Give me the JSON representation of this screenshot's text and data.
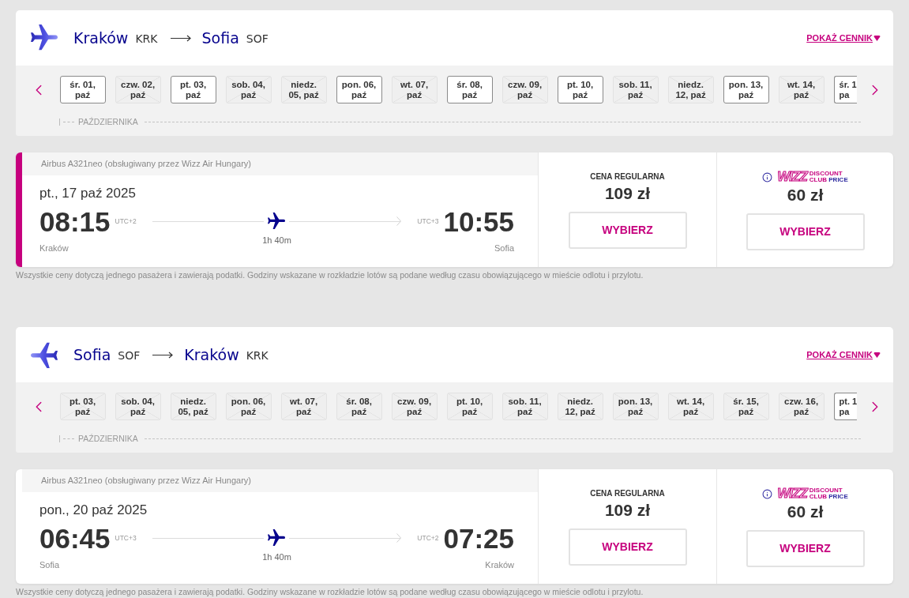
{
  "sections": [
    {
      "kind": "outbound",
      "origin": {
        "city": "Kraków",
        "code": "KRK"
      },
      "destination": {
        "city": "Sofia",
        "code": "SOF"
      },
      "price_list_link": "POKAŻ CENNIK",
      "dates": [
        {
          "lines": [
            "śr. 01,",
            "paź"
          ],
          "available": true
        },
        {
          "lines": [
            "czw. 02,",
            "paź"
          ],
          "available": false
        },
        {
          "lines": [
            "pt. 03,",
            "paź"
          ],
          "available": true
        },
        {
          "lines": [
            "sob. 04,",
            "paź"
          ],
          "available": false
        },
        {
          "lines": [
            "niedz.",
            "05, paź"
          ],
          "available": false
        },
        {
          "lines": [
            "pon. 06,",
            "paź"
          ],
          "available": true
        },
        {
          "lines": [
            "wt. 07,",
            "paź"
          ],
          "available": false
        },
        {
          "lines": [
            "śr. 08,",
            "paź"
          ],
          "available": true
        },
        {
          "lines": [
            "czw. 09,",
            "paź"
          ],
          "available": false
        },
        {
          "lines": [
            "pt. 10,",
            "paź"
          ],
          "available": true
        },
        {
          "lines": [
            "sob. 11,",
            "paź"
          ],
          "available": false
        },
        {
          "lines": [
            "niedz.",
            "12, paź"
          ],
          "available": false
        },
        {
          "lines": [
            "pon. 13,",
            "paź"
          ],
          "available": true
        },
        {
          "lines": [
            "wt. 14,",
            "paź"
          ],
          "available": false
        },
        {
          "lines": [
            "śr. 1",
            "pa"
          ],
          "available": true,
          "cut": true
        }
      ],
      "month_label": "PAŹDZIERNIKA",
      "flight": {
        "selected": true,
        "aircraft": "Airbus A321neo (obsługiwany przez Wizz Air Hungary)",
        "date": "pt., 17 paź 2025",
        "departure": {
          "time": "08:15",
          "utc": "UTC+2",
          "city": "Kraków"
        },
        "arrival": {
          "time": "10:55",
          "utc": "UTC+3",
          "city": "Sofia"
        },
        "duration": "1h 40m",
        "fares": [
          {
            "kind": "regular",
            "label": "CENA REGULARNA",
            "price": "109 zł",
            "button": "WYBIERZ"
          },
          {
            "kind": "club",
            "logo": "WIZZ",
            "badge": [
              "DISCOUNT",
              "CLUB",
              "PRICE"
            ],
            "price": "60 zł",
            "button": "WYBIERZ"
          }
        ]
      },
      "note": "Wszystkie ceny dotyczą jednego pasażera i zawierają podatki. Godziny wskazane w rozkładzie lotów są podane według czasu obowiązującego w mieście odlotu i przylotu."
    },
    {
      "kind": "return",
      "origin": {
        "city": "Sofia",
        "code": "SOF"
      },
      "destination": {
        "city": "Kraków",
        "code": "KRK"
      },
      "price_list_link": "POKAŻ CENNIK",
      "dates": [
        {
          "lines": [
            "pt. 03,",
            "paź"
          ],
          "available": false
        },
        {
          "lines": [
            "sob. 04,",
            "paź"
          ],
          "available": false
        },
        {
          "lines": [
            "niedz.",
            "05, paź"
          ],
          "available": false
        },
        {
          "lines": [
            "pon. 06,",
            "paź"
          ],
          "available": false
        },
        {
          "lines": [
            "wt. 07,",
            "paź"
          ],
          "available": false
        },
        {
          "lines": [
            "śr. 08,",
            "paź"
          ],
          "available": false
        },
        {
          "lines": [
            "czw. 09,",
            "paź"
          ],
          "available": false
        },
        {
          "lines": [
            "pt. 10,",
            "paź"
          ],
          "available": false
        },
        {
          "lines": [
            "sob. 11,",
            "paź"
          ],
          "available": false
        },
        {
          "lines": [
            "niedz.",
            "12, paź"
          ],
          "available": false
        },
        {
          "lines": [
            "pon. 13,",
            "paź"
          ],
          "available": false
        },
        {
          "lines": [
            "wt. 14,",
            "paź"
          ],
          "available": false
        },
        {
          "lines": [
            "śr. 15,",
            "paź"
          ],
          "available": false
        },
        {
          "lines": [
            "czw. 16,",
            "paź"
          ],
          "available": false
        },
        {
          "lines": [
            "pt. 1",
            "pa"
          ],
          "available": true,
          "cut": true
        }
      ],
      "month_label": "PAŹDZIERNIKA",
      "flight": {
        "selected": false,
        "aircraft": "Airbus A321neo (obsługiwany przez Wizz Air Hungary)",
        "date": "pon., 20 paź 2025",
        "departure": {
          "time": "06:45",
          "utc": "UTC+3",
          "city": "Sofia"
        },
        "arrival": {
          "time": "07:25",
          "utc": "UTC+2",
          "city": "Kraków"
        },
        "duration": "1h 40m",
        "fares": [
          {
            "kind": "regular",
            "label": "CENA REGULARNA",
            "price": "109 zł",
            "button": "WYBIERZ"
          },
          {
            "kind": "club",
            "logo": "WIZZ",
            "badge": [
              "DISCOUNT",
              "CLUB",
              "PRICE"
            ],
            "price": "60 zł",
            "button": "WYBIERZ"
          }
        ]
      },
      "note": "Wszystkie ceny dotyczą jednego pasażera i zawierają podatki. Godziny wskazane w rozkładzie lotów są podane według czasu obowiązującego w mieście odlotu i przylotu."
    }
  ]
}
